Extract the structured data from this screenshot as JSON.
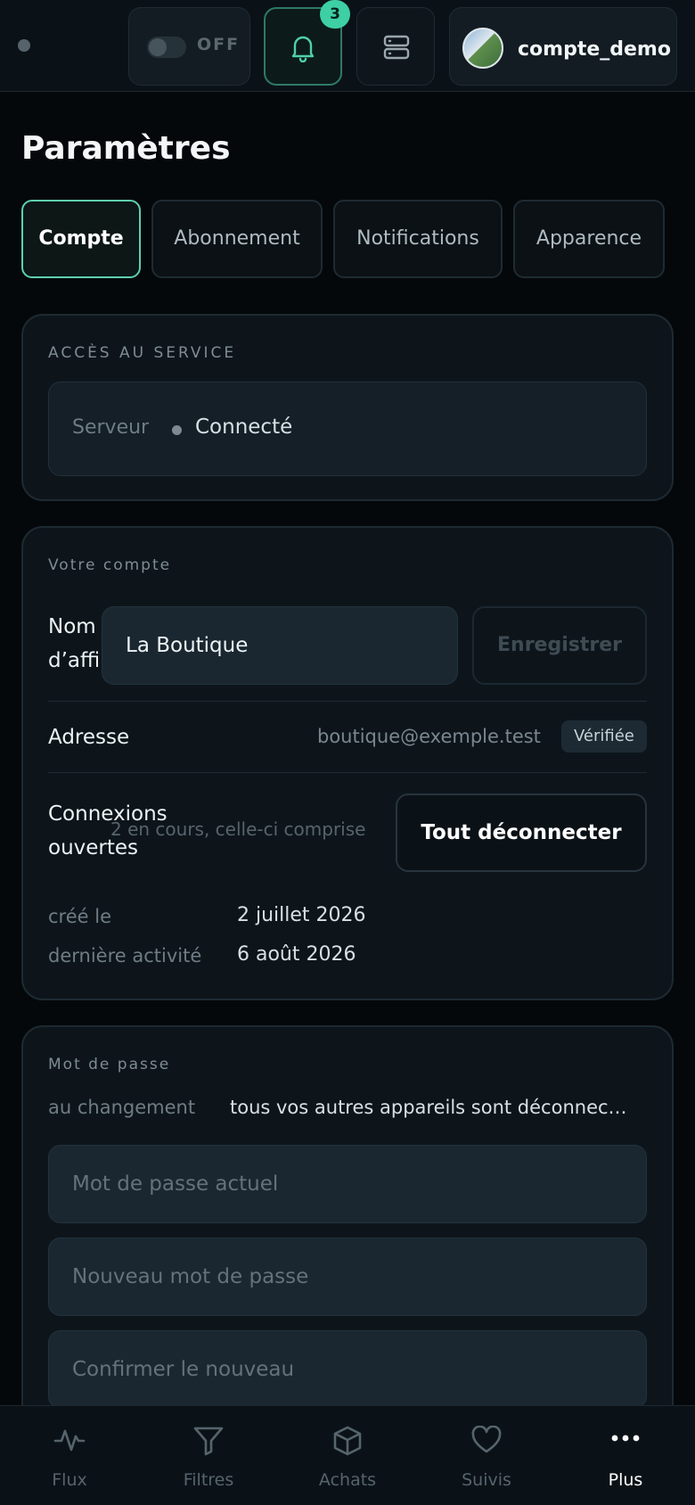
{
  "header": {
    "toggle_label": "OFF",
    "notification_count": "3",
    "username": "compte_demo"
  },
  "page": {
    "title": "Paramètres"
  },
  "tabs": [
    {
      "label": "Compte",
      "active": true
    },
    {
      "label": "Abonnement",
      "active": false
    },
    {
      "label": "Notifications",
      "active": false
    },
    {
      "label": "Apparence",
      "active": false
    }
  ],
  "service": {
    "section_label": "ACCÈS AU SERVICE",
    "server_label": "Serveur",
    "server_status": "Connecté"
  },
  "account": {
    "section_label": "Votre compte",
    "display_name_label_line1": "Nom",
    "display_name_label_line2": "d’affi",
    "display_name_value": "La Boutique",
    "save_label": "Enregistrer",
    "address_label": "Adresse",
    "address_value": "boutique@exemple.test",
    "verified_badge": "Vérifiée",
    "sessions_label_line1": "Connexions",
    "sessions_label_line2": "ouvertes",
    "sessions_hint": "2 en cours, celle-ci comprise",
    "logout_all_label": "Tout déconnecter",
    "created_label": "créé le",
    "created_value": "2 juillet 2026",
    "last_activity_label": "dernière activité",
    "last_activity_value": "6 août 2026"
  },
  "password": {
    "section_label": "Mot de passe",
    "change_label": "au changement",
    "change_note": "tous vos autres appareils sont déconnec…",
    "current_placeholder": "Mot de passe actuel",
    "new_placeholder": "Nouveau mot de passe",
    "confirm_placeholder": "Confirmer le nouveau"
  },
  "nav": [
    {
      "label": "Flux",
      "icon": "activity-icon"
    },
    {
      "label": "Filtres",
      "icon": "filter-icon"
    },
    {
      "label": "Achats",
      "icon": "box-icon"
    },
    {
      "label": "Suivis",
      "icon": "heart-icon"
    },
    {
      "label": "Plus",
      "icon": "more-icon"
    }
  ],
  "colors": {
    "accent": "#3ecfa4",
    "background": "#05080a",
    "card": "#0d151b"
  }
}
